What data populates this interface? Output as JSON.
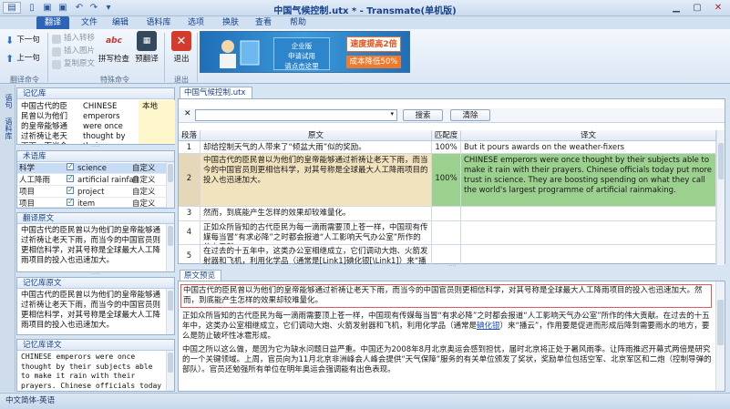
{
  "window": {
    "title": "中国气候控制.utx * - Transmate(单机版)"
  },
  "menu_tabs": [
    "翻译",
    "文件",
    "编辑",
    "语料库",
    "选项",
    "换肤",
    "查看",
    "帮助"
  ],
  "ribbon": {
    "translate_group": {
      "next": "下一句",
      "prev": "上一句",
      "label": "翻译命令"
    },
    "special_group": {
      "insert_tag": "插入转移",
      "insert_image": "插入图片",
      "copy_source": "复制原文",
      "spell_check": "拼写检查",
      "spell_check_icon_text": "abc",
      "pretranslate": "预翻译",
      "label": "特殊命令"
    },
    "exit_group": {
      "exit": "退出",
      "label": "退出"
    }
  },
  "banner": {
    "enterprise_line1": "企业版",
    "enterprise_line2": "申请试用",
    "enterprise_line3": "请点击这里",
    "speed": "速度提高2倍",
    "cost": "成本降低50%"
  },
  "side_tabs": [
    "语句",
    "语料库"
  ],
  "memory_panel": {
    "title": "记忆库",
    "source": "中国古代的臣民曾以为他们的皇帝能够通过祈祷让老天下雨，而当今的",
    "target": "CHINESE emperors were once thought by their subjects able to make it rain",
    "origin": "本地"
  },
  "term_panel": {
    "title": "术语库",
    "rows": [
      {
        "src": "科学",
        "tgt": "science",
        "type": "自定义"
      },
      {
        "src": "人工降雨",
        "tgt": "artificial rainfall",
        "type": "自定义"
      },
      {
        "src": "项目",
        "tgt": "project",
        "type": "自定义"
      },
      {
        "src": "项目",
        "tgt": "item",
        "type": "自定义"
      }
    ]
  },
  "translation_source_panel": {
    "title": "翻译原文",
    "text": "中国古代的臣民曾以为他们的皇帝能够通过祈祷让老天下雨，而当今的中国官员则更相信科学，对其号称是全球最大人工降雨项目的投入也迅速加大。"
  },
  "memory_source_panel": {
    "title": "记忆库原文",
    "text": "中国古代的臣民曾以为他们的皇帝能够通过祈祷让老天下雨，而当今的中国官员则更相信科学，对其号称是全球最大人工降雨项目的投入也迅速加大。"
  },
  "memory_target_panel": {
    "title": "记忆库译文",
    "text": "CHINESE emperors were once thought by their subjects able to make it rain with their prayers. Chinese officials today"
  },
  "document": {
    "tab": "中国气候控制.utx",
    "close_x": "✕",
    "search_button": "搜索",
    "clear_button": "清除",
    "columns": {
      "num": "段落",
      "source": "原文",
      "match": "匹配度",
      "target": "译文"
    },
    "rows": [
      {
        "num": "1",
        "source": "却给控制天气的人带来了“倾盆大雨”似的奖励。",
        "match": "100%",
        "target": "But it pours awards on the weather-fixers"
      },
      {
        "num": "2",
        "source": "中国古代的臣民曾以为他们的皇帝能够通过祈祷让老天下雨，而当今的中国官员则更相信科学，对其号称是全球最大人工降雨项目的投入也迅速加大。",
        "match": "100%",
        "target": "CHINESE emperors were once thought by their subjects able to make it rain with their prayers. Chinese officials today put more trust in science. They are boosting spending on what they call the world's largest programme of artificial rainmaking."
      },
      {
        "num": "3",
        "source": "然而，到底能产生怎样的效果却较难量化。",
        "match": "",
        "target": ""
      },
      {
        "num": "4",
        "source": "正如众所皆知的古代臣民为每一滴雨需要顶上苍一样，中国现有传媒每当冒“有求必降”之时都会报道“人工影响天气办公室”所作的伟大贡献。",
        "match": "",
        "target": ""
      },
      {
        "num": "5",
        "source": "在过去的十五年中，这类办公室相继成立，它们调动大炮、火箭发射器和飞机，利用化学品（通常是[Link1]碘化银[\\Link1]）来“播云”，作用要是促进而期待而是",
        "match": "",
        "target": ""
      }
    ]
  },
  "preview": {
    "tab": "原文预览",
    "p1": "中国古代的臣民曾以为他们的皇帝能够通过祈祷让老天下雨，而当今的中国官员则更相信科学，对其号称是全球最大人工降雨项目的投入也迅速加大。然而，到底能产生怎样的效果却较难量化。",
    "p2a": "正如众所皆知的古代臣民为每一滴雨需要顶上苍一样，中国现有传媒每当冒“有求必降”之时都会报道“人工影响天气办公室”所作的伟大贡献。在过去的十五年中，这类办公室相继成立，它们调动大炮、火箭发射器和飞机，利用化学品（通常是",
    "p2_link": "碘化银",
    "p2b": "）来“播云”，作用要是促进而形成后降到需要雨水的地方，要么是防止破坏性冰雹形成。",
    "p3": "中国之所以这么做，是因为它为缺水问题日益严重。中国还为2008年8月北京奥运会感到担忧，届时北京将正处于暑风雨季。让阵雨推迟开幕式两倍是研究的一个关键领域。上周，官员向为11月北京非洲峰会人峰会提供“天气保障”服务的有关单位颁发了奖状，奖励单位包括空军、北京军区和二炮（控制导弹的部队）。官员还勉强所有单位在明年奥运会强调能有出色表现。"
  },
  "status": {
    "language_pair": "中文简体-英语"
  }
}
